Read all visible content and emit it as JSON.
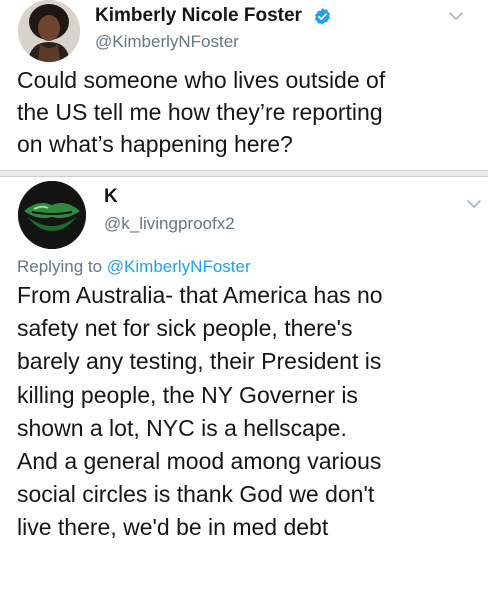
{
  "tweet1": {
    "display_name": "Kimberly Nicole Foster",
    "handle": "@KimberlyNFoster",
    "verified": true,
    "lines": [
      "Could someone who lives outside of",
      "the US tell me how they’re reporting",
      "on what’s happening here?"
    ]
  },
  "tweet2": {
    "display_name": "K",
    "handle": "@k_livingproofx2",
    "replying_to_label": "Replying to ",
    "replying_to_handle": "@KimberlyNFoster",
    "lines": [
      "From Australia- that America has no",
      "safety net for sick people, there's",
      "barely any testing, their President is",
      "killing people, the NY Governer is",
      "shown a lot, NYC is a hellscape.",
      "And a general mood among various",
      "social circles is thank God we don't",
      "live there, we'd be in med debt"
    ]
  },
  "icons": {
    "verified": "verified-badge-icon",
    "menu": "chevron-down-icon"
  },
  "colors": {
    "text": "#14171a",
    "secondary": "#657786",
    "link": "#1da1f2",
    "verified": "#1da1f2"
  }
}
